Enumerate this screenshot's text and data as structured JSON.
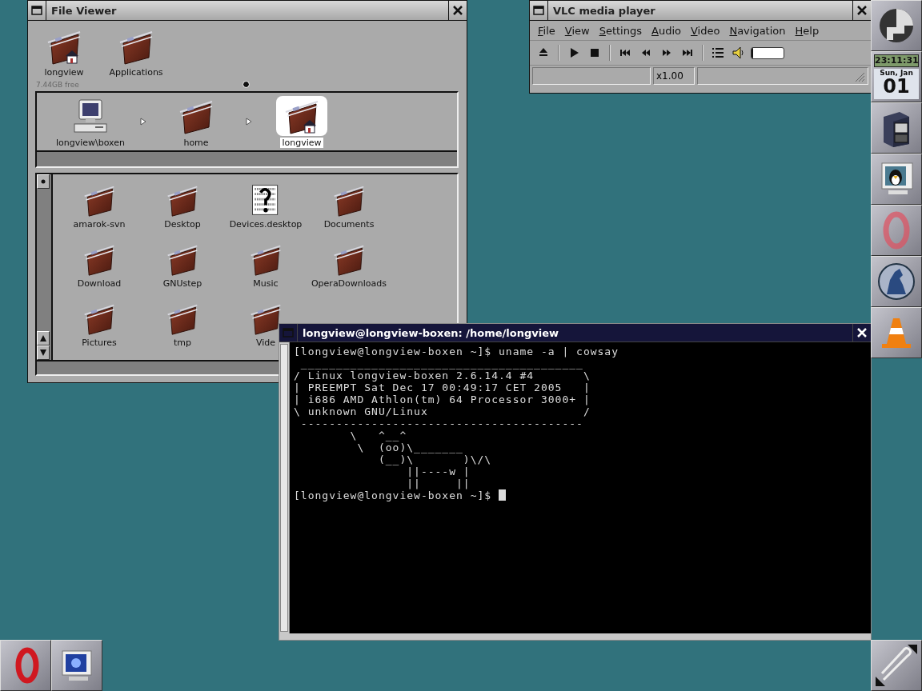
{
  "file_viewer": {
    "title": "File Viewer",
    "shelf": [
      {
        "label": "longview",
        "kind": "home-folder"
      },
      {
        "label": "Applications",
        "kind": "folder"
      }
    ],
    "free_space": "7.44GB free",
    "path": [
      {
        "label": "longview\\boxen",
        "kind": "computer",
        "selected": false
      },
      {
        "label": "home",
        "kind": "folder",
        "selected": false
      },
      {
        "label": "longview",
        "kind": "home-folder",
        "selected": true
      }
    ],
    "files": [
      {
        "label": "amarok-svn",
        "kind": "folder"
      },
      {
        "label": "Desktop",
        "kind": "folder"
      },
      {
        "label": "Devices.desktop",
        "kind": "document"
      },
      {
        "label": "Documents",
        "kind": "folder"
      },
      {
        "label": "Download",
        "kind": "folder"
      },
      {
        "label": "GNUstep",
        "kind": "folder"
      },
      {
        "label": "Music",
        "kind": "folder"
      },
      {
        "label": "OperaDownloads",
        "kind": "folder"
      },
      {
        "label": "Pictures",
        "kind": "folder"
      },
      {
        "label": "tmp",
        "kind": "folder"
      },
      {
        "label": "Vide",
        "kind": "folder"
      }
    ]
  },
  "vlc": {
    "title": "VLC media player",
    "menu": [
      "File",
      "View",
      "Settings",
      "Audio",
      "Video",
      "Navigation",
      "Help"
    ],
    "volume": {
      "level": 0.06
    },
    "speed": "x1.00"
  },
  "terminal": {
    "title": "longview@longview-boxen: /home/longview",
    "lines": [
      "[longview@longview-boxen ~]$ uname -a | cowsay",
      " ________________________________________",
      "/ Linux longview-boxen 2.6.14.4 #4       \\",
      "| PREEMPT Sat Dec 17 00:49:17 CET 2005   |",
      "| i686 AMD Athlon(tm) 64 Processor 3000+ |",
      "\\ unknown GNU/Linux                      /",
      " ----------------------------------------",
      "        \\   ^__^",
      "         \\  (oo)\\_______",
      "            (__)\\       )\\/\\",
      "                ||----w |",
      "                ||     ||",
      "[longview@longview-boxen ~]$ "
    ]
  },
  "clock": {
    "time": "23:11:31",
    "date": "Sun, Jan",
    "day": "01"
  }
}
